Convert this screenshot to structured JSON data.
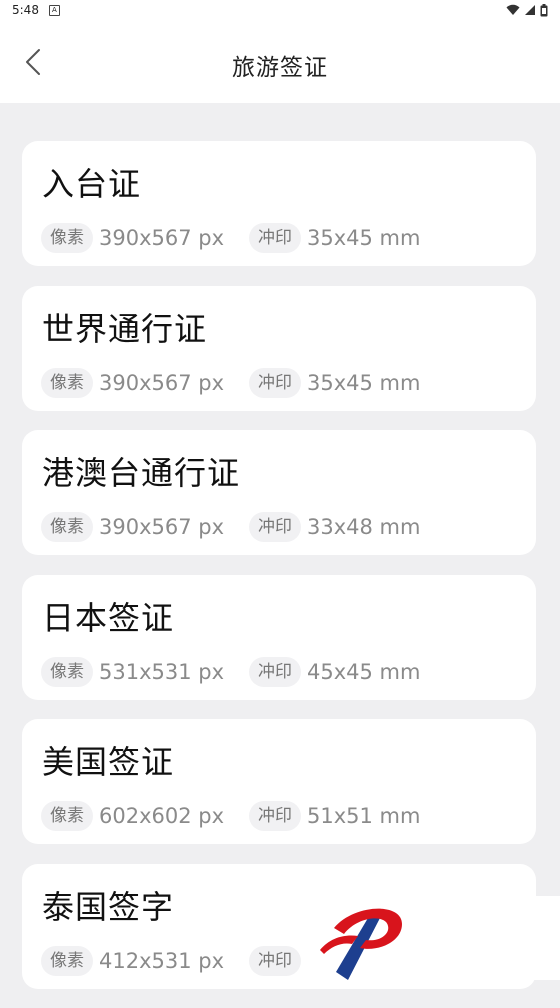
{
  "status_bar": {
    "time": "5:48",
    "badge": "A"
  },
  "header": {
    "title": "旅游签证"
  },
  "labels": {
    "pixel_tag": "像素",
    "print_tag": "冲印"
  },
  "items": [
    {
      "title": "入台证",
      "pixels": "390x567 px",
      "print": "35x45 mm"
    },
    {
      "title": "世界通行证",
      "pixels": "390x567 px",
      "print": "35x45 mm"
    },
    {
      "title": "港澳台通行证",
      "pixels": "390x567 px",
      "print": "33x48 mm"
    },
    {
      "title": "日本签证",
      "pixels": "531x531 px",
      "print": "45x45 mm"
    },
    {
      "title": "美国签证",
      "pixels": "602x602 px",
      "print": "51x51 mm"
    },
    {
      "title": "泰国签字",
      "pixels": "412x531 px",
      "print": ""
    }
  ],
  "colors": {
    "background": "#efeff1",
    "card": "#ffffff",
    "logo_red": "#d8141c",
    "logo_blue": "#1d3f8f"
  }
}
